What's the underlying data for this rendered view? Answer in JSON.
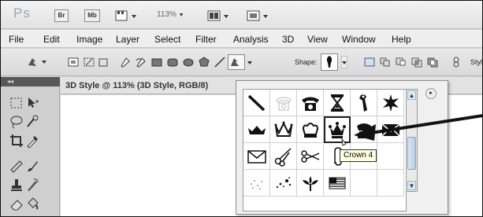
{
  "app": {
    "logo": "Ps",
    "zoom": "113%"
  },
  "titlebar": {
    "bridge_label": "Br",
    "minibridge_label": "Mb"
  },
  "menu": [
    "File",
    "Edit",
    "Image",
    "Layer",
    "Select",
    "Filter",
    "Analysis",
    "3D",
    "View",
    "Window",
    "Help"
  ],
  "options_bar": {
    "shape_label": "Shape:",
    "style_label": "Style"
  },
  "tools_panel": {
    "header": "◂◂"
  },
  "document": {
    "tab_title": "3D Style @ 113% (3D Style, RGB/8)"
  },
  "shape_picker": {
    "menu_icon": "▸",
    "selected_shape": "crown-4",
    "shapes": [
      "line-shape",
      "phone-outline",
      "phone-dial",
      "hourglass",
      "bird-banner",
      "seal-star",
      "crown-1",
      "crown-2",
      "crown-3",
      "crown-4",
      "crown-5",
      "envelope-filled",
      "envelope",
      "scissors-1",
      "scissors-2",
      "paperclip",
      "blank-1",
      "blank-2",
      "dotted-stars",
      "scatter",
      "fleur-leaf",
      "flag",
      "blank-3",
      "blank-4"
    ]
  },
  "tooltip": {
    "text": "Crown 4"
  },
  "colors": {
    "accent_arrow": "#111111",
    "tooltip_bg": "#ffffe1"
  }
}
